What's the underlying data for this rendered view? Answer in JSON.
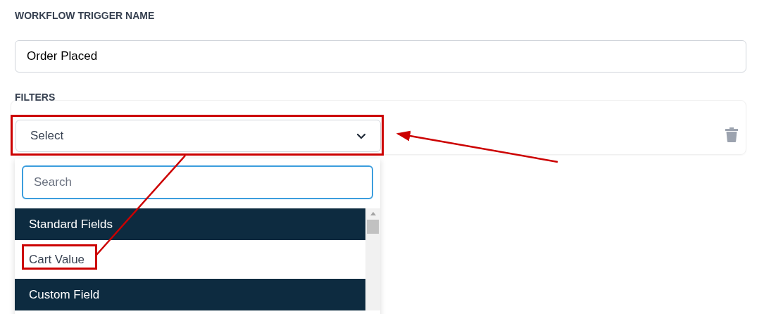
{
  "trigger_name": {
    "label": "WORKFLOW TRIGGER NAME",
    "value": "Order Placed"
  },
  "filters": {
    "label": "FILTERS",
    "select": {
      "placeholder": "Select",
      "expanded": true
    },
    "dropdown": {
      "search": {
        "placeholder": "Search"
      },
      "items": [
        {
          "kind": "group",
          "label": "Standard Fields"
        },
        {
          "kind": "option",
          "label": "Cart Value"
        },
        {
          "kind": "group",
          "label": "Custom Field"
        }
      ]
    }
  }
}
